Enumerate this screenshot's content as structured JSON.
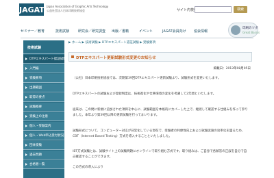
{
  "header": {
    "logo": "JAGAT",
    "logo_sub": "Japan Association of Graphic Arts Technology",
    "logo_sub2": "公益社団法人日本印刷技術協会",
    "search_label": "サイト内検索",
    "search_placeholder": "",
    "search_button": "検索"
  },
  "nav": {
    "items": [
      "セミナー／教育",
      "技術試験",
      "研究会／研究調査",
      "出版／書籍",
      "イベント",
      "JAGAT会員向け",
      "協会情報"
    ]
  },
  "badge": {
    "title": "印刷のツボ",
    "sub": "Great Basics"
  },
  "sidebar": {
    "title": "技術試験",
    "items": [
      "DTPエキスパート認証試験",
      "入門編",
      "受験要項",
      "出題範囲",
      "取得の要点",
      "試験概要",
      "受験上の注意",
      "個人・受験案内",
      "個人・Web申込受付状況",
      "団体受験",
      "過去問題",
      "合格者一覧"
    ]
  },
  "main": {
    "breadcrumb": "▶ ホーム ▶ 技術試験 ▶ DTPエキスパート認証試験 ▶ 受験要項",
    "title": "DTPエキスパート更新試験形式変更のお知らせ",
    "date": "掲載日：2013年08月05日",
    "paragraphs": [
      "（公社）日本印刷技術協会では、次期第39回DTPエキスパート更新試験より、試験形式を変更いたします。",
      "DTPエキスパートの試験および登録制度は、技術進化や仕事環境の変化を考慮して2年間といたします。",
      "従来は、この間に新規に追加された項目を中心に、試験範囲を本格的にカバーした上で、継続して確認する仕組みを作って参りました。本年より第39回以降の更新試験を行ってまいります。",
      "試験形式について、コンピューター対応が日常化している現在で、受験者の利便性向上および試験実施の効率化を図るため、CBT（Internet Based Testing）方式を導入することといたしました。",
      "IBT方式試験とは、試験サイト上の試験問題にオンラインで取り組む方式です。取り組みは、ご自身で各解答の正誤を自分で自己確認することができます。",
      "この方式の導入により"
    ]
  }
}
